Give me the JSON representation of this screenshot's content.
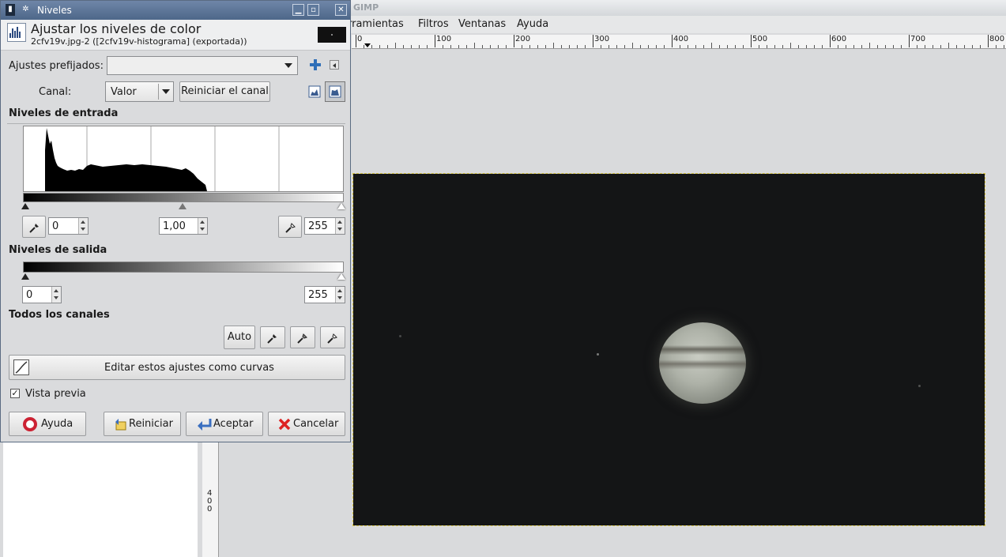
{
  "gimp": {
    "app_title": "GIMP",
    "menus": [
      "rramientas",
      "Filtros",
      "Ventanas",
      "Ayuda"
    ],
    "ruler_labels": [
      "0",
      "100",
      "200",
      "300",
      "400",
      "500",
      "600",
      "700",
      "800"
    ],
    "vruler_label": "400"
  },
  "dialog": {
    "window_title": "Niveles",
    "header_title": "Ajustar los niveles de color",
    "header_subtitle": "2cfv19v.jpg-2 ([2cfv19v-histograma] (exportada))",
    "presets_label": "Ajustes prefijados:",
    "presets_value": "",
    "channel_label": "Canal:",
    "channel_value": "Valor",
    "reset_channel": "Reiniciar el canal",
    "input_levels": "Niveles de entrada",
    "input_black": "0",
    "input_gamma": "1,00",
    "input_white": "255",
    "output_levels": "Niveles de salida",
    "output_black": "0",
    "output_white": "255",
    "all_channels": "Todos los canales",
    "auto_label": "Auto",
    "edit_curves": "Editar estos ajustes como curvas",
    "preview_label": "Vista previa",
    "preview_checked": true,
    "buttons": {
      "help": "Ayuda",
      "reset": "Reiniciar",
      "ok": "Aceptar",
      "cancel": "Cancelar"
    }
  },
  "colors": {
    "title_bar": "#5a7398",
    "canvas_bg": "#141516",
    "selection_outline": "#d8c64a"
  }
}
